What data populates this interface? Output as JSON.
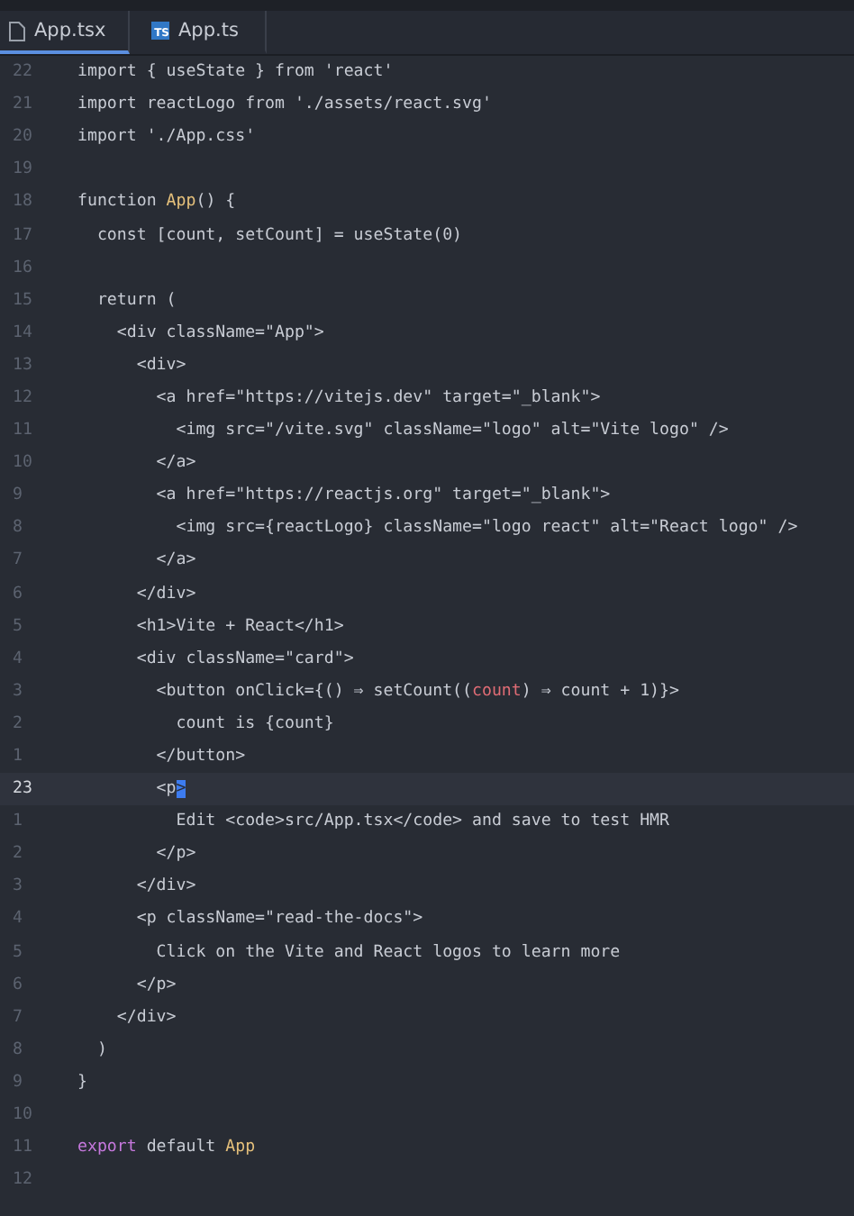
{
  "tabs": [
    {
      "label": "App.tsx",
      "kind": "file",
      "selected": true
    },
    {
      "label": "App.ts",
      "kind": "typescript",
      "badge": "TS",
      "selected": false
    }
  ],
  "editor": {
    "lines": [
      {
        "number": "22",
        "current": false,
        "tokens": [
          {
            "text": "import { useState } from 'react'",
            "kind": "plain"
          }
        ]
      },
      {
        "number": "21",
        "current": false,
        "tokens": [
          {
            "text": "import reactLogo from './assets/react.svg'",
            "kind": "plain"
          }
        ]
      },
      {
        "number": "20",
        "current": false,
        "tokens": [
          {
            "text": "import './App.css'",
            "kind": "plain"
          }
        ]
      },
      {
        "number": "19",
        "current": false
      },
      {
        "number": "18",
        "current": false,
        "tokens": [
          {
            "text": "function ",
            "kind": "plain"
          },
          {
            "text": "App",
            "kind": "name"
          },
          {
            "text": "() {",
            "kind": "plain"
          }
        ]
      },
      {
        "number": "17",
        "current": false,
        "tokens": [
          {
            "text": "  const [count, setCount] = useState(0)",
            "kind": "plain"
          }
        ]
      },
      {
        "number": "16",
        "current": false
      },
      {
        "number": "15",
        "current": false,
        "tokens": [
          {
            "text": "  return (",
            "kind": "plain"
          }
        ]
      },
      {
        "number": "14",
        "current": false,
        "tokens": [
          {
            "text": "    <div className=\"App\">",
            "kind": "plain"
          }
        ]
      },
      {
        "number": "13",
        "current": false,
        "tokens": [
          {
            "text": "      <div>",
            "kind": "plain"
          }
        ]
      },
      {
        "number": "12",
        "current": false,
        "tokens": [
          {
            "text": "        <a href=\"https://vitejs.dev\" target=\"_blank\">",
            "kind": "plain"
          }
        ]
      },
      {
        "number": "11",
        "current": false,
        "tokens": [
          {
            "text": "          <img src=\"/vite.svg\" className=\"logo\" alt=\"Vite logo\" />",
            "kind": "plain"
          }
        ]
      },
      {
        "number": "10",
        "current": false,
        "tokens": [
          {
            "text": "        </a>",
            "kind": "plain"
          }
        ]
      },
      {
        "number": "9",
        "current": false,
        "tokens": [
          {
            "text": "        <a href=\"https://reactjs.org\" target=\"_blank\">",
            "kind": "plain"
          }
        ]
      },
      {
        "number": "8",
        "current": false,
        "tokens": [
          {
            "text": "          <img src={reactLogo} className=\"logo react\" alt=\"React logo\" />",
            "kind": "plain"
          }
        ]
      },
      {
        "number": "7",
        "current": false,
        "tokens": [
          {
            "text": "        </a>",
            "kind": "plain"
          }
        ]
      },
      {
        "number": "6",
        "current": false,
        "tokens": [
          {
            "text": "      </div>",
            "kind": "plain"
          }
        ]
      },
      {
        "number": "5",
        "current": false,
        "tokens": [
          {
            "text": "      <h1>Vite + React</h1>",
            "kind": "plain"
          }
        ]
      },
      {
        "number": "4",
        "current": false,
        "tokens": [
          {
            "text": "      <div className=\"card\">",
            "kind": "plain"
          }
        ]
      },
      {
        "number": "3",
        "current": false,
        "tokens": [
          {
            "text": "        <button onClick={() ⇒ setCount((",
            "kind": "plain"
          },
          {
            "text": "count",
            "kind": "param"
          },
          {
            "text": ") ⇒ count + 1)}>",
            "kind": "plain"
          }
        ]
      },
      {
        "number": "2",
        "current": false,
        "tokens": [
          {
            "text": "          count is {count}",
            "kind": "plain"
          }
        ]
      },
      {
        "number": "1",
        "current": false,
        "tokens": [
          {
            "text": "        </button>",
            "kind": "plain"
          }
        ]
      },
      {
        "number": "23",
        "current": true,
        "tokens": [
          {
            "text": "        <p",
            "kind": "plain"
          },
          {
            "text": ">",
            "kind": "selection"
          }
        ]
      },
      {
        "number": "1",
        "current": false,
        "tokens": [
          {
            "text": "          Edit <code>src/App.tsx</code> and save to test HMR",
            "kind": "plain"
          }
        ]
      },
      {
        "number": "2",
        "current": false,
        "tokens": [
          {
            "text": "        </p>",
            "kind": "plain"
          }
        ]
      },
      {
        "number": "3",
        "current": false,
        "tokens": [
          {
            "text": "      </div>",
            "kind": "plain"
          }
        ]
      },
      {
        "number": "4",
        "current": false,
        "tokens": [
          {
            "text": "      <p className=\"read-the-docs\">",
            "kind": "plain"
          }
        ]
      },
      {
        "number": "5",
        "current": false,
        "tokens": [
          {
            "text": "        Click on the Vite and React logos to learn more",
            "kind": "plain"
          }
        ]
      },
      {
        "number": "6",
        "current": false,
        "tokens": [
          {
            "text": "      </p>",
            "kind": "plain"
          }
        ]
      },
      {
        "number": "7",
        "current": false,
        "tokens": [
          {
            "text": "    </div>",
            "kind": "plain"
          }
        ]
      },
      {
        "number": "8",
        "current": false,
        "tokens": [
          {
            "text": "  )",
            "kind": "plain"
          }
        ]
      },
      {
        "number": "9",
        "current": false,
        "tokens": [
          {
            "text": "}",
            "kind": "plain"
          }
        ]
      },
      {
        "number": "10",
        "current": false
      },
      {
        "number": "11",
        "current": false,
        "tokens": [
          {
            "text": "export",
            "kind": "keyword"
          },
          {
            "text": " default ",
            "kind": "plain"
          },
          {
            "text": "App",
            "kind": "name"
          }
        ]
      },
      {
        "number": "12",
        "current": false
      }
    ]
  }
}
